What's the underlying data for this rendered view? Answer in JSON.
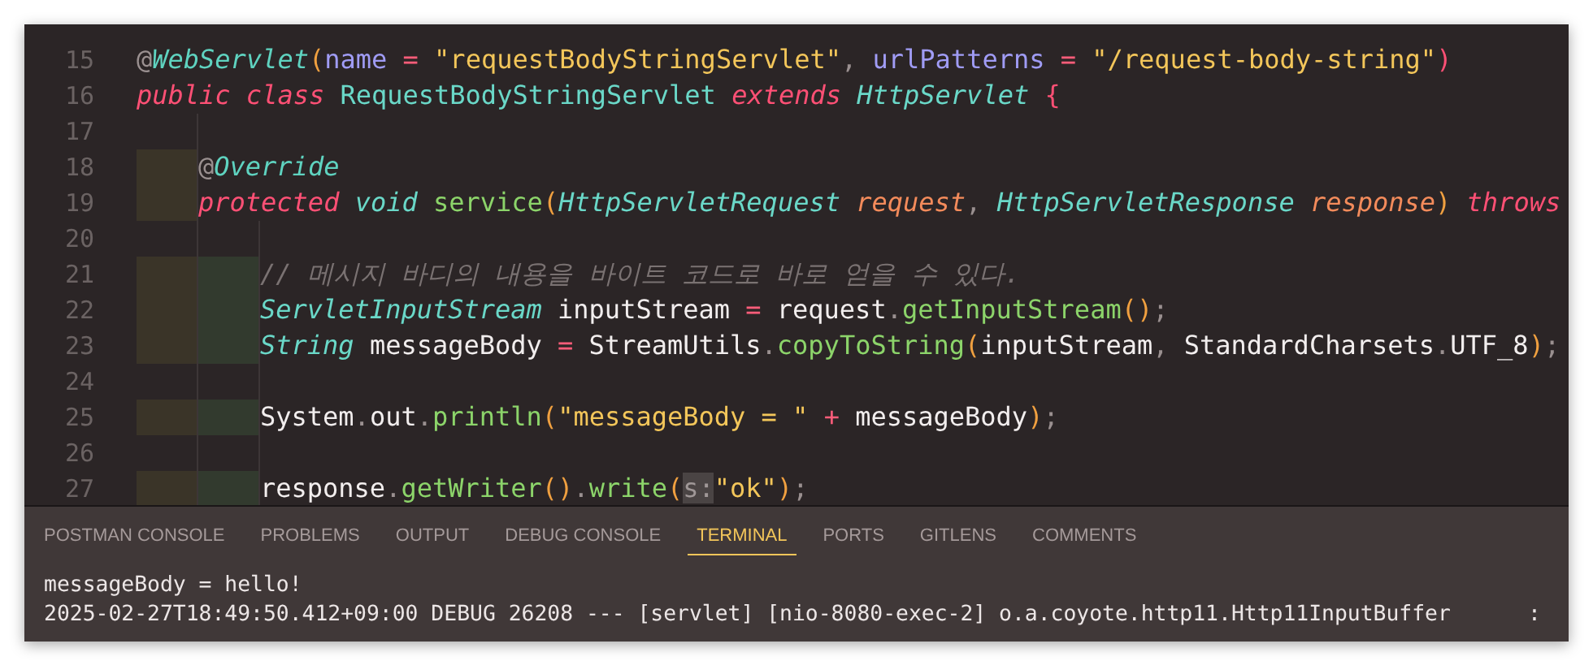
{
  "editor": {
    "lines": [
      {
        "number": "15",
        "tokens": [
          {
            "kind": "at",
            "text": "@"
          },
          {
            "kind": "annotation",
            "text": "WebServlet"
          },
          {
            "kind": "paren",
            "text": "("
          },
          {
            "kind": "attr",
            "text": "name"
          },
          {
            "kind": "op",
            "text": " = "
          },
          {
            "kind": "string",
            "text": "\"requestBodyStringServlet\""
          },
          {
            "kind": "punct",
            "text": ", "
          },
          {
            "kind": "attr",
            "text": "urlPatterns"
          },
          {
            "kind": "op",
            "text": " = "
          },
          {
            "kind": "string",
            "text": "\"/request-body-string\""
          },
          {
            "kind": "brace",
            "text": ")"
          }
        ]
      },
      {
        "number": "16",
        "tokens": [
          {
            "kind": "keyword",
            "text": "public class "
          },
          {
            "kind": "class",
            "text": "RequestBodyStringServlet "
          },
          {
            "kind": "keyword",
            "text": "extends "
          },
          {
            "kind": "type",
            "text": "HttpServlet "
          },
          {
            "kind": "brace",
            "text": "{"
          }
        ],
        "children": [
          {
            "number": "17"
          },
          {
            "number": "18",
            "tokens": [
              {
                "kind": "at",
                "text": "@"
              },
              {
                "kind": "annotation",
                "text": "Override"
              }
            ]
          },
          {
            "number": "19",
            "tokens": [
              {
                "kind": "keyword",
                "text": "protected "
              },
              {
                "kind": "type",
                "text": "void "
              },
              {
                "kind": "method",
                "text": "service"
              },
              {
                "kind": "paren",
                "text": "("
              },
              {
                "kind": "type",
                "text": "HttpServletRequest "
              },
              {
                "kind": "param",
                "text": "request"
              },
              {
                "kind": "punct",
                "text": ", "
              },
              {
                "kind": "type",
                "text": "HttpServletResponse "
              },
              {
                "kind": "param",
                "text": "response"
              },
              {
                "kind": "paren",
                "text": ") "
              },
              {
                "kind": "keyword",
                "text": "throws"
              }
            ],
            "children": [
              {
                "number": "20"
              },
              {
                "number": "21",
                "tokens": [
                  {
                    "kind": "comment",
                    "text": "// 메시지 바디의 내용을 바이트 코드로 바로 얻을 수 있다."
                  }
                ]
              },
              {
                "number": "22",
                "tokens": [
                  {
                    "kind": "type",
                    "text": "ServletInputStream "
                  },
                  {
                    "kind": "plain",
                    "text": "inputStream "
                  },
                  {
                    "kind": "op",
                    "text": "= "
                  },
                  {
                    "kind": "plain",
                    "text": "request"
                  },
                  {
                    "kind": "punct",
                    "text": "."
                  },
                  {
                    "kind": "method",
                    "text": "getInputStream"
                  },
                  {
                    "kind": "paren",
                    "text": "()"
                  },
                  {
                    "kind": "punct",
                    "text": ";"
                  }
                ]
              },
              {
                "number": "23",
                "tokens": [
                  {
                    "kind": "type",
                    "text": "String "
                  },
                  {
                    "kind": "plain",
                    "text": "messageBody "
                  },
                  {
                    "kind": "op",
                    "text": "= "
                  },
                  {
                    "kind": "plain",
                    "text": "StreamUtils"
                  },
                  {
                    "kind": "punct",
                    "text": "."
                  },
                  {
                    "kind": "method",
                    "text": "copyToString"
                  },
                  {
                    "kind": "paren",
                    "text": "("
                  },
                  {
                    "kind": "plain",
                    "text": "inputStream"
                  },
                  {
                    "kind": "punct",
                    "text": ", "
                  },
                  {
                    "kind": "plain",
                    "text": "StandardCharsets"
                  },
                  {
                    "kind": "punct",
                    "text": "."
                  },
                  {
                    "kind": "plain",
                    "text": "UTF_8"
                  },
                  {
                    "kind": "paren",
                    "text": ")"
                  },
                  {
                    "kind": "punct",
                    "text": ";"
                  }
                ]
              },
              {
                "number": "24"
              },
              {
                "number": "25",
                "tokens": [
                  {
                    "kind": "plain",
                    "text": "System"
                  },
                  {
                    "kind": "punct",
                    "text": "."
                  },
                  {
                    "kind": "plain",
                    "text": "out"
                  },
                  {
                    "kind": "punct",
                    "text": "."
                  },
                  {
                    "kind": "method",
                    "text": "println"
                  },
                  {
                    "kind": "paren",
                    "text": "("
                  },
                  {
                    "kind": "string",
                    "text": "\"messageBody = \" "
                  },
                  {
                    "kind": "op",
                    "text": "+ "
                  },
                  {
                    "kind": "plain",
                    "text": "messageBody"
                  },
                  {
                    "kind": "paren",
                    "text": ")"
                  },
                  {
                    "kind": "punct",
                    "text": ";"
                  }
                ]
              },
              {
                "number": "26"
              },
              {
                "number": "27",
                "tokens": [
                  {
                    "kind": "plain",
                    "text": "response"
                  },
                  {
                    "kind": "punct",
                    "text": "."
                  },
                  {
                    "kind": "method",
                    "text": "getWriter"
                  },
                  {
                    "kind": "paren",
                    "text": "()"
                  },
                  {
                    "kind": "punct",
                    "text": "."
                  },
                  {
                    "kind": "method",
                    "text": "write"
                  },
                  {
                    "kind": "paren",
                    "text": "("
                  },
                  {
                    "kind": "hint",
                    "text": "s:"
                  },
                  {
                    "kind": "string",
                    "text": "\"ok\""
                  },
                  {
                    "kind": "paren",
                    "text": ")"
                  },
                  {
                    "kind": "punct",
                    "text": ";"
                  }
                ]
              }
            ]
          }
        ]
      }
    ]
  },
  "panel": {
    "tabs": [
      {
        "label": "POSTMAN CONSOLE",
        "selected": false
      },
      {
        "label": "PROBLEMS",
        "selected": false
      },
      {
        "label": "OUTPUT",
        "selected": false
      },
      {
        "label": "DEBUG CONSOLE",
        "selected": false
      },
      {
        "label": "TERMINAL",
        "selected": true
      },
      {
        "label": "PORTS",
        "selected": false
      },
      {
        "label": "GITLENS",
        "selected": false
      },
      {
        "label": "COMMENTS",
        "selected": false
      }
    ],
    "terminal_lines": [
      "messageBody = hello!",
      "2025-02-27T18:49:50.412+09:00 DEBUG 26208 --- [servlet] [nio-8080-exec-2] o.a.coyote.http11.Http11InputBuffer      :"
    ]
  }
}
